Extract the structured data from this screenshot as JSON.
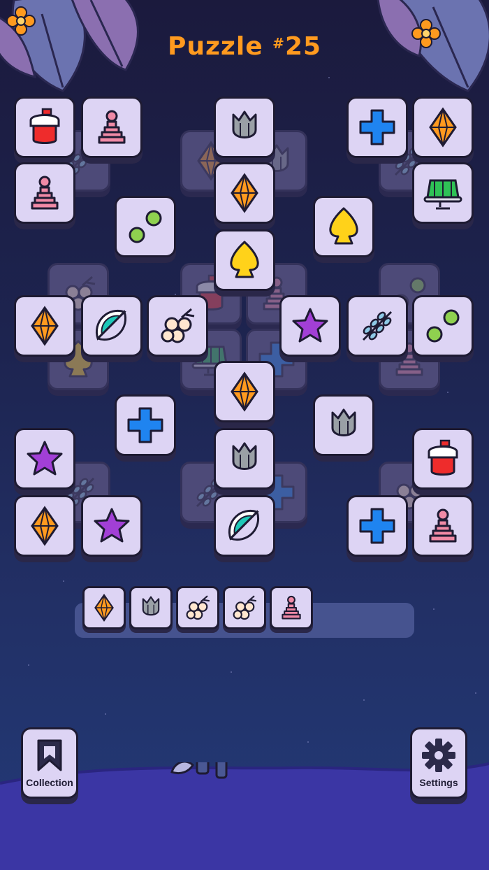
{
  "header": {
    "title_word": "Puzzle",
    "title_hash": "#",
    "title_number": "25"
  },
  "icons": {
    "gear": "gear-icon",
    "bookmark": "bookmark-icon",
    "flower": "flower-icon",
    "tile_types": [
      "potion",
      "pawn",
      "tulip",
      "plus",
      "diamond",
      "two-dots",
      "jelly",
      "spade",
      "lime-slice",
      "berries",
      "star",
      "leaves"
    ]
  },
  "colors": {
    "accent": "#ff9a1f",
    "tile": "#ddd4f4",
    "tile_border": "#1e1b33",
    "tray": "#4a5894",
    "ground": "#3b36a4"
  },
  "board": {
    "top_layer": [
      "potion",
      "pawn",
      "tulip",
      "plus",
      "diamond",
      "pawn",
      "diamond",
      "jelly",
      "two-dots",
      "spade",
      "spade",
      "diamond",
      "lime-slice",
      "berries",
      "star",
      "leaves",
      "two-dots",
      "diamond",
      "plus",
      "tulip",
      "star",
      "tulip",
      "potion",
      "diamond",
      "star",
      "lime-slice",
      "plus",
      "pawn"
    ],
    "tray_tiles": [
      "diamond",
      "tulip",
      "berries",
      "berries",
      "pawn"
    ]
  },
  "footer": {
    "collection_label": "Collection",
    "settings_label": "Settings"
  }
}
